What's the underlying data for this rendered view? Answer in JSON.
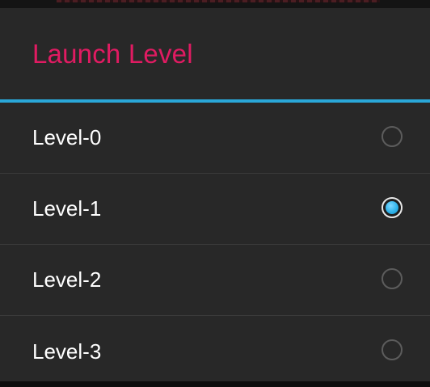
{
  "dialog": {
    "title": "Launch Level",
    "accent_color": "#2aa7d8",
    "title_color": "#e01b62",
    "options": [
      {
        "label": "Level-0",
        "selected": false
      },
      {
        "label": "Level-1",
        "selected": true
      },
      {
        "label": "Level-2",
        "selected": false
      },
      {
        "label": "Level-3",
        "selected": false
      }
    ]
  }
}
